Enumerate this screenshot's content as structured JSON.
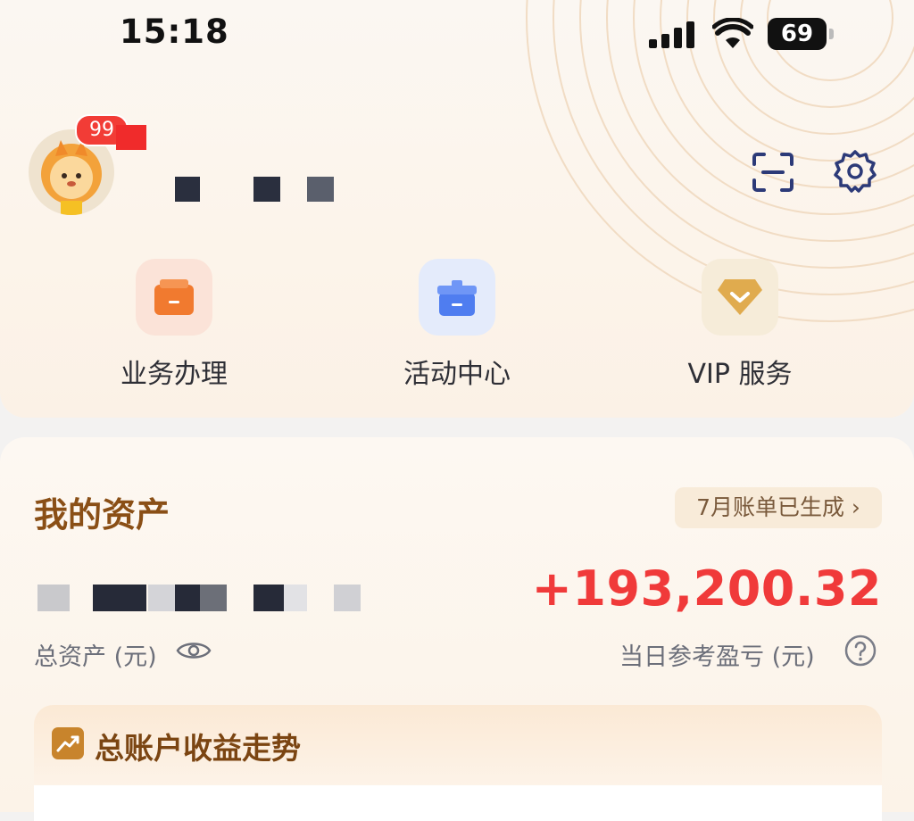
{
  "status_bar": {
    "time": "15:18",
    "battery": "69"
  },
  "profile": {
    "notification_count": "99"
  },
  "quick_actions": [
    {
      "label": "业务办理",
      "icon": "briefcase-icon",
      "color": "#f17a2f"
    },
    {
      "label": "活动中心",
      "icon": "gift-box-icon",
      "color": "#4f7df0"
    },
    {
      "label": "VIP 服务",
      "icon": "diamond-icon",
      "color": "#d9a44e"
    }
  ],
  "assets": {
    "title": "我的资产",
    "bill_link": "7月账单已生成 ›",
    "total_assets_label": "总资产 (元)",
    "daily_pnl": "+193,200.32",
    "daily_pnl_label": "当日参考盈亏 (元)"
  },
  "trend": {
    "title": "总账户收益走势"
  },
  "colors": {
    "accent_red": "#f03a3a",
    "title_brown": "#8a4f16"
  }
}
